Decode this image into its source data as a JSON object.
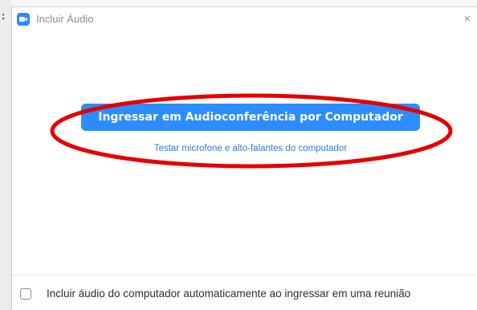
{
  "left_strip": {
    "glyph": ":"
  },
  "window": {
    "title": "Incluir Áudio",
    "close_glyph": "×"
  },
  "main": {
    "join_button_label": "Ingressar em Audioconferência por Computador",
    "test_link_label": "Testar microfone e alto-falantes do computador"
  },
  "footer": {
    "checkbox_label": "Incluir áudio do computador automaticamente ao ingressar em uma reunião",
    "checkbox_checked": false
  },
  "colors": {
    "accent": "#2d8cff",
    "link": "#2d7de0",
    "annotation": "#e60000"
  },
  "icons": {
    "app": "zoom-camera-icon",
    "close": "close-icon"
  }
}
